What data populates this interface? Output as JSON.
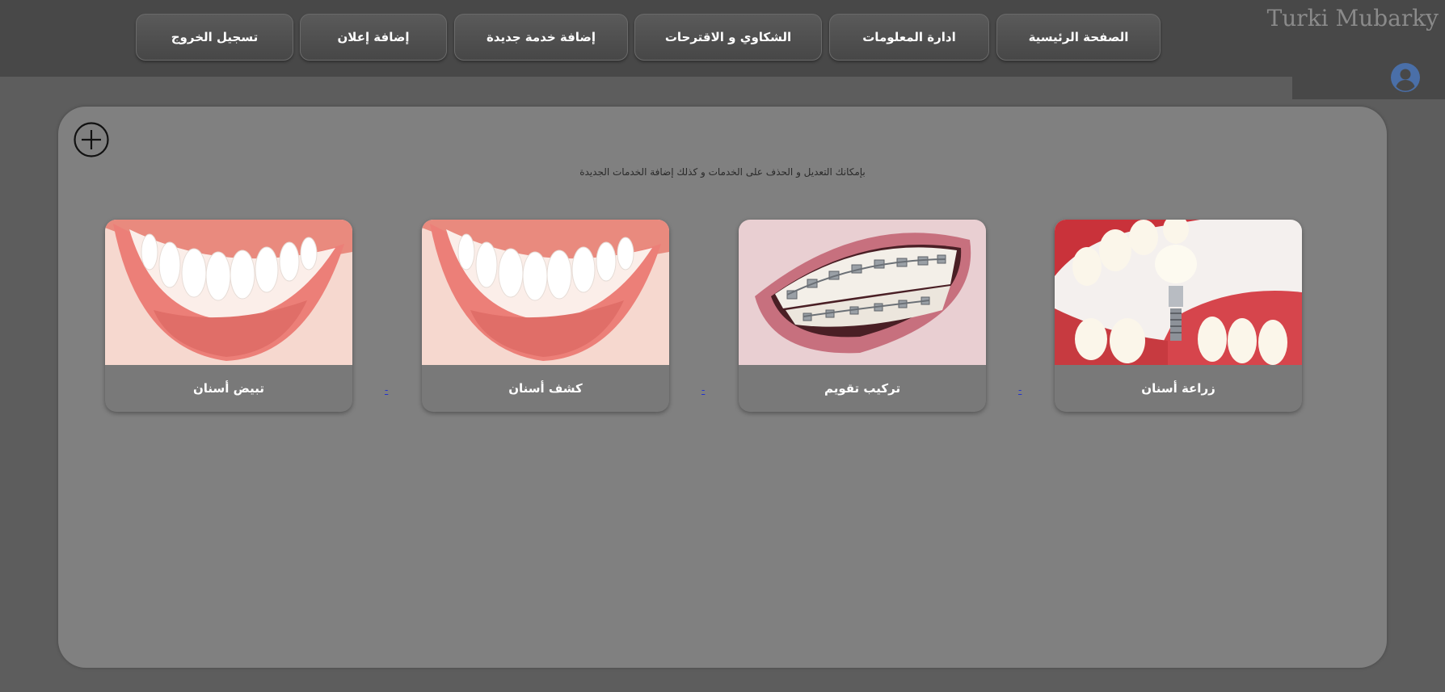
{
  "nav": {
    "home": "الصفحة الرئيسية",
    "manage_info": "ادارة المعلومات",
    "complaints": "الشكاوي و الاقترحات",
    "add_service": "إضافة خدمة جديدة",
    "add_ad": "إضافة إعلان",
    "logout": "تسجيل الخروج"
  },
  "user": {
    "name": "Turki Mubarky",
    "avatar_icon": "user-circle-icon"
  },
  "main": {
    "add_icon": "plus-circle-icon",
    "hint": "بإمكانك التعديل و الحذف على الخدمات و كذلك إضافة الخدمات الجديدة",
    "services": [
      {
        "label": "زراعة أسنان",
        "image": "dental-implant-image"
      },
      {
        "label": "تركيب تقويم",
        "image": "braces-smile-image"
      },
      {
        "label": "كشف أسنان",
        "image": "white-smile-image"
      },
      {
        "label": "تبيض أسنان",
        "image": "white-smile-image"
      }
    ],
    "separator_text": "-"
  },
  "colors": {
    "topbar": "#484848",
    "page_bg": "#5d5d5d",
    "card_bg": "#808080",
    "link": "#2233cc"
  }
}
